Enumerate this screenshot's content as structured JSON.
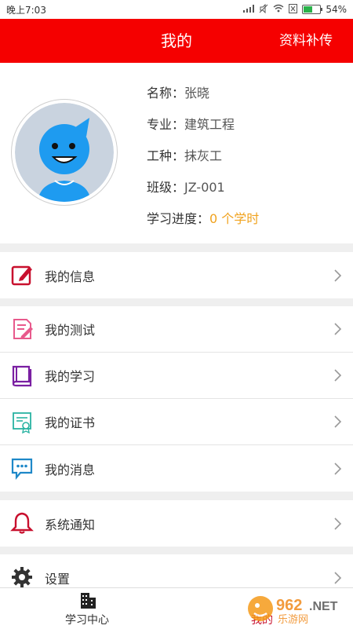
{
  "status": {
    "time": "晚上7:03",
    "battery": "54%",
    "battery_level": 0.54
  },
  "header": {
    "title": "我的",
    "action": "资料补传"
  },
  "profile": {
    "name_label": "名称：",
    "name": "张晓",
    "major_label": "专业：",
    "major": "建筑工程",
    "trade_label": "工种：",
    "trade": "抹灰工",
    "class_label": "班级：",
    "class": "JZ-001",
    "progress_label": "学习进度：",
    "progress": "0 个学时"
  },
  "menu": {
    "info": "我的信息",
    "test": "我的测试",
    "study": "我的学习",
    "cert": "我的证书",
    "message": "我的消息",
    "notice": "系统通知",
    "settings": "设置"
  },
  "tabbar": {
    "study_center": "学习中心",
    "mine": "我的"
  },
  "watermark": "962.NET 乐游网",
  "colors": {
    "header": "#f50000",
    "accent": "#f0a21e"
  }
}
